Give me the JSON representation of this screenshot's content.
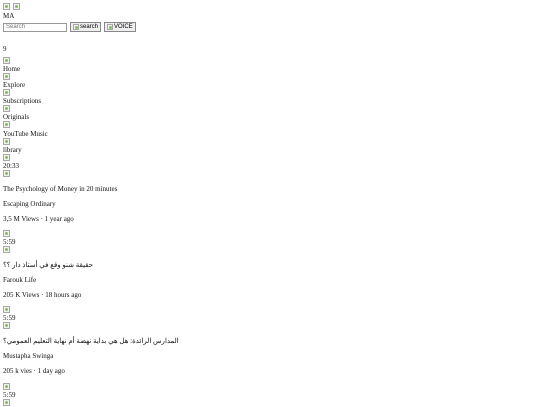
{
  "header": {
    "avatar_text": "MA",
    "search_placeholder": "Search",
    "search_button_label": "search",
    "voice_button_label": "VOICE"
  },
  "notifications_count": "9",
  "nav": [
    {
      "label": "Home"
    },
    {
      "label": "Explore"
    },
    {
      "label": "Subscriptions"
    },
    {
      "label": "Originals"
    },
    {
      "label": "YouTube Music"
    },
    {
      "label": "library"
    }
  ],
  "videos": [
    {
      "duration": "20:33",
      "title": "The Psychology of Money in 20 minutes",
      "channel": "Escaping Ordinary",
      "meta": "3,5 M Views · 1 year ago"
    },
    {
      "duration": "5:59",
      "title": "حقيقة شنو وقع في أستاذ دار ؟؟",
      "channel": "Farouk Life",
      "meta": "205 K Views · 18 hours ago"
    },
    {
      "duration": "5:59",
      "title": "المدارس الرائدة: هل هي بداية نهضة أم نهاية التعليم العمومي؟",
      "channel": "Mustapha Swinga",
      "meta": "205 k vies · 1 day ago"
    },
    {
      "duration": "5:59"
    }
  ]
}
